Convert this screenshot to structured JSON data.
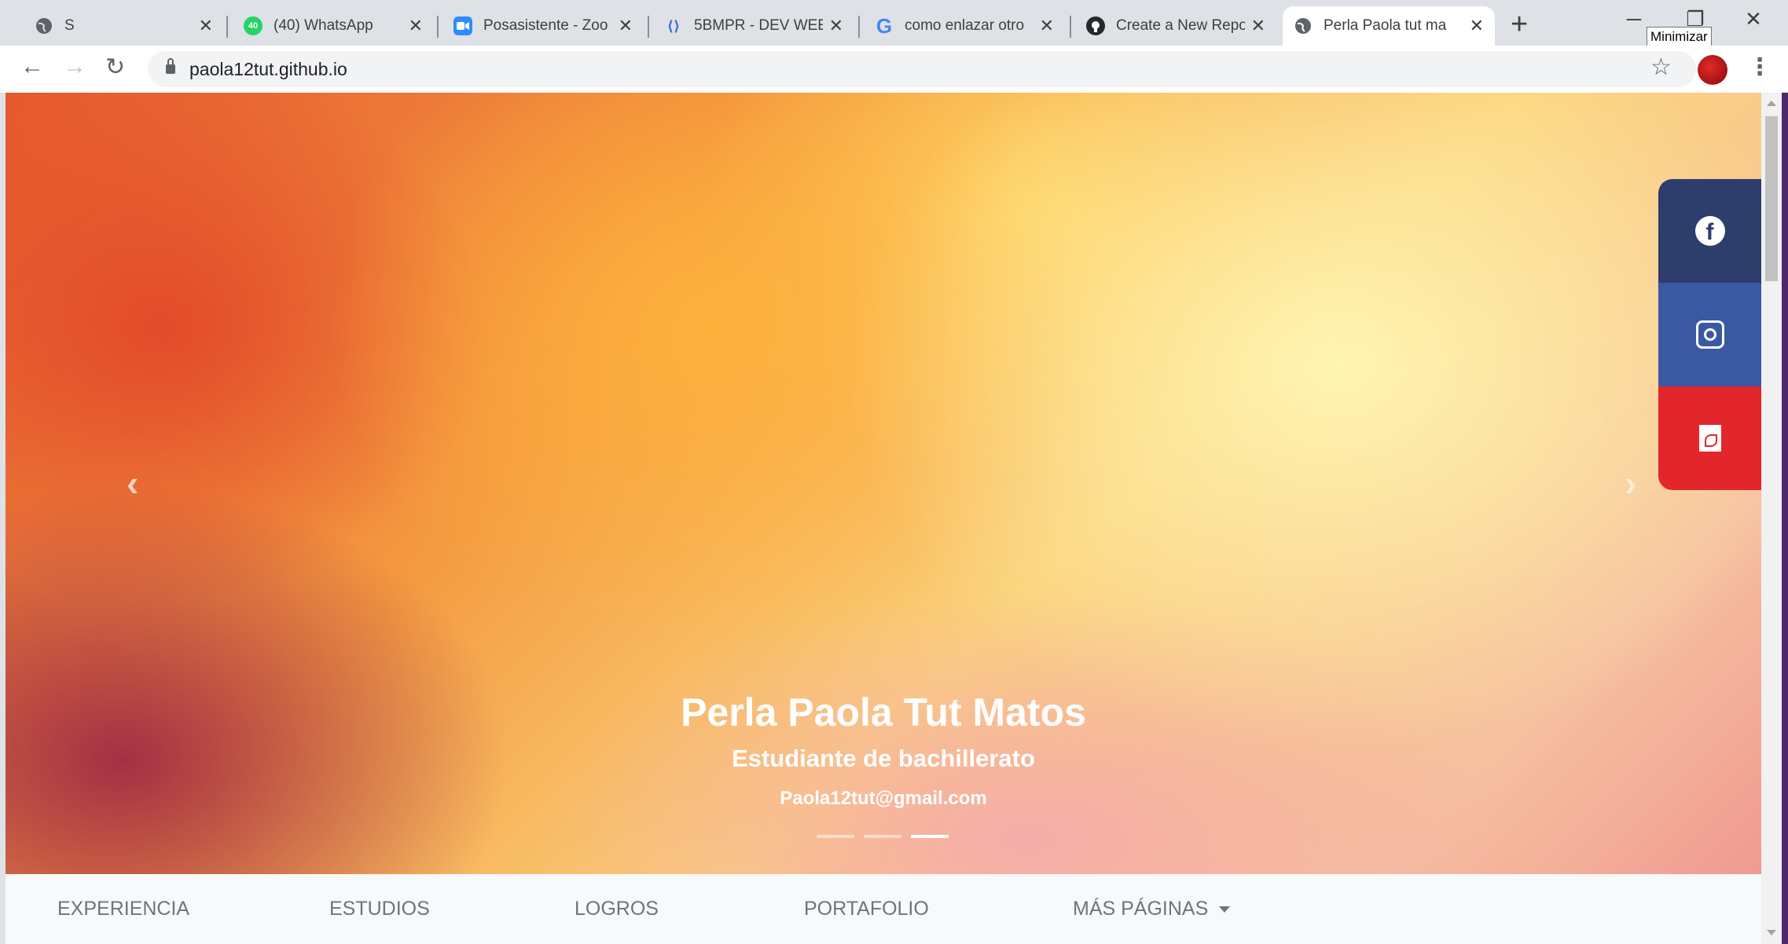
{
  "browser": {
    "tabs": [
      {
        "title": "S",
        "icon": "globe-icon"
      },
      {
        "title": "(40) WhatsApp",
        "icon": "whatsapp-icon",
        "badge": "40"
      },
      {
        "title": "Posasistente - Zoo",
        "icon": "zoom-icon"
      },
      {
        "title": "5BMPR - DEV WEE",
        "icon": "radio-icon"
      },
      {
        "title": "como enlazar otro",
        "icon": "google-icon"
      },
      {
        "title": "Create a New Repo",
        "icon": "github-icon"
      },
      {
        "title": "Perla Paola tut ma",
        "icon": "globe-icon",
        "active": true
      }
    ],
    "new_tab": "+",
    "tooltip": "Minimizar",
    "url": "paola12tut.github.io"
  },
  "hero": {
    "name": "Perla Paola Tut Matos",
    "role": "Estudiante de bachillerato",
    "email": "Paola12tut@gmail.com",
    "slides_total": 3,
    "active_slide": 3
  },
  "social": [
    {
      "name": "facebook",
      "color": "#2d3d6c"
    },
    {
      "name": "instagram",
      "color": "#3b58a3"
    },
    {
      "name": "pdf",
      "color": "#e3262b"
    }
  ],
  "nav": {
    "items": [
      "EXPERIENCIA",
      "ESTUDIOS",
      "LOGROS",
      "PORTAFOLIO",
      "MÁS PÁGINAS"
    ]
  }
}
